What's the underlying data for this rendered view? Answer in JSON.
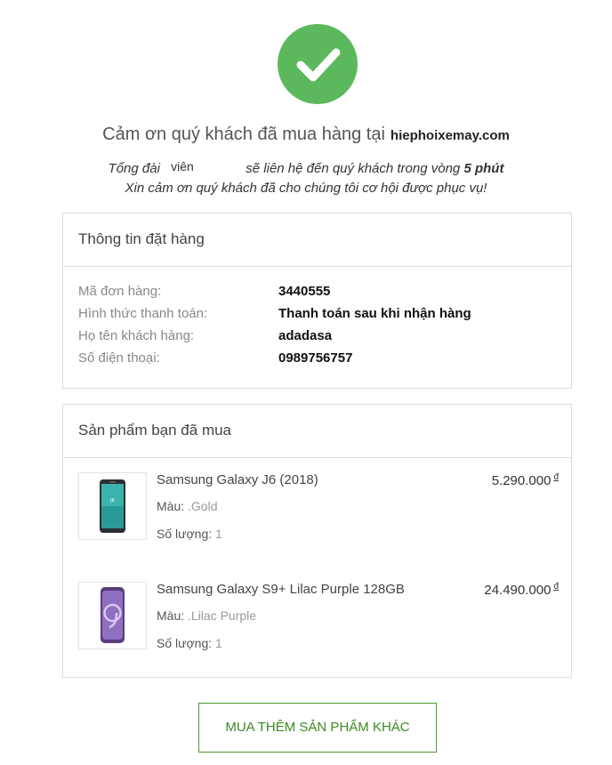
{
  "header": {
    "thanks_text": "Cảm ơn quý khách đã mua hàng tại",
    "site_name": "hiephoixemay.com",
    "contact_prefix": "Tổng đài",
    "contact_staff": "viên",
    "contact_middle": "sẽ liên hệ đến quý khách trong vòng",
    "contact_time": "5 phút",
    "appreciation": "Xin cảm ơn quý khách đã cho chúng tôi cơ hội được phục vụ!",
    "success_icon": "checkmark-icon",
    "success_color": "#5cb85c"
  },
  "order": {
    "title": "Thông tin đặt hàng",
    "rows": [
      {
        "label": "Mã đơn hàng:",
        "value": "3440555"
      },
      {
        "label": "Hình thức thanh toán:",
        "value": "Thanh toán sau khi nhận hàng"
      },
      {
        "label": "Họ tên khách hàng:",
        "value": "adadasa"
      },
      {
        "label": "Số điện thoại:",
        "value": "0989756757"
      }
    ]
  },
  "products": {
    "title": "Sản phẩm bạn đã mua",
    "color_label": "Màu:",
    "quantity_label": "Số lượng:",
    "currency": "đ",
    "items": [
      {
        "name": "Samsung Galaxy J6 (2018)",
        "price": "5.290.000",
        "color": ".Gold",
        "quantity": "1",
        "image_icon": "phone-gold-icon"
      },
      {
        "name": "Samsung Galaxy S9+ Lilac Purple 128GB",
        "price": "24.490.000",
        "color": ".Lilac Purple",
        "quantity": "1",
        "image_icon": "phone-purple-icon"
      }
    ]
  },
  "actions": {
    "buy_more_label": "MUA THÊM SẢN PHẨM KHÁC",
    "accent_color": "#3c8a22"
  }
}
